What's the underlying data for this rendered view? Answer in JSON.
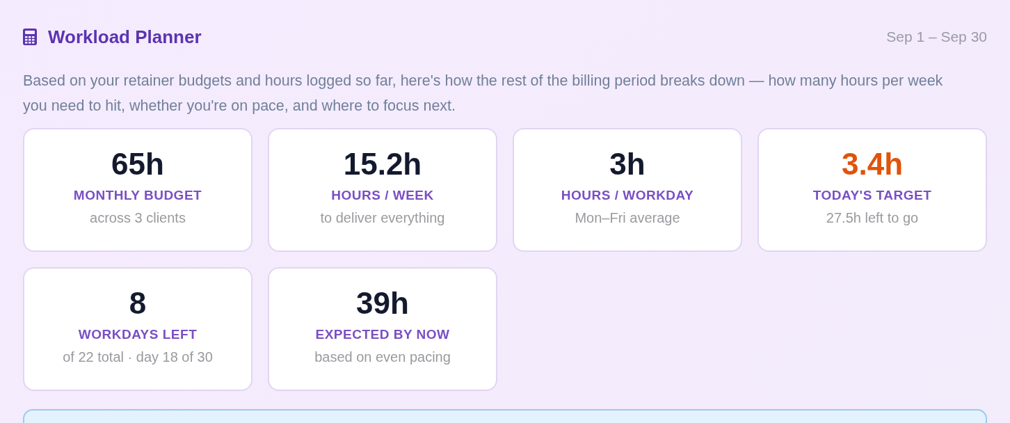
{
  "header": {
    "title": "Workload Planner",
    "period": "Sep 1 – Sep 30"
  },
  "description": "Based on your retainer budgets and hours logged so far, here's how the rest of the billing period breaks down — how many hours per week you need to hit, whether you're on pace, and where to focus next.",
  "stats": [
    {
      "value": "65h",
      "label": "MONTHLY BUDGET",
      "note": "across 3 clients",
      "highlight": false
    },
    {
      "value": "15.2h",
      "label": "HOURS / WEEK",
      "note": "to deliver everything",
      "highlight": false
    },
    {
      "value": "3h",
      "label": "HOURS / WORKDAY",
      "note": "Mon–Fri average",
      "highlight": false
    },
    {
      "value": "3.4h",
      "label": "TODAY'S TARGET",
      "note": "27.5h left to go",
      "highlight": true
    },
    {
      "value": "8",
      "label": "WORKDAYS LEFT",
      "note": "of 22 total · day 18 of 30",
      "highlight": false
    },
    {
      "value": "39h",
      "label": "EXPECTED BY NOW",
      "note": "based on even pacing",
      "highlight": false
    }
  ]
}
